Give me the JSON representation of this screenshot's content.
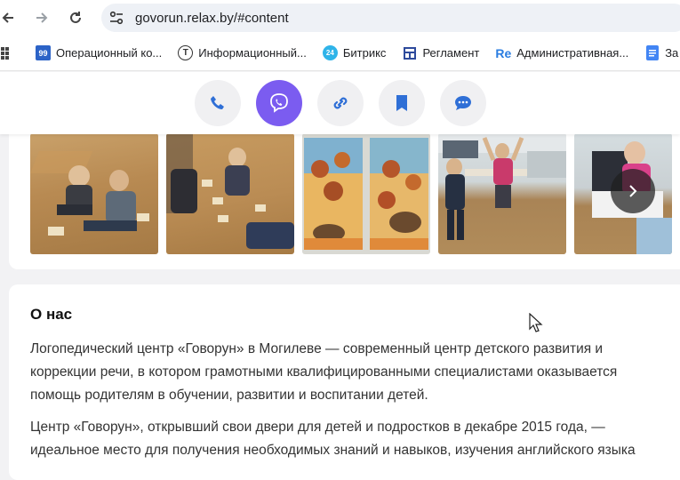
{
  "browser": {
    "url": "govorun.relax.by/#content",
    "bookmarks": [
      {
        "label": "Операционный ко...",
        "icon": "99-icon",
        "icon_text": "99",
        "color": "#2c63c7"
      },
      {
        "label": "Информационный...",
        "icon": "t-circle-icon",
        "icon_text": "T",
        "color": "#333333"
      },
      {
        "label": "Битрикс",
        "icon": "bitrix24-icon",
        "icon_text": "24",
        "color": "#2fb4e9"
      },
      {
        "label": "Регламент",
        "icon": "grid-doc-icon",
        "icon_text": "",
        "color": "#2d4a9c"
      },
      {
        "label": "Административная...",
        "icon": "re-icon",
        "icon_text": "Re",
        "color": "#2a7de1"
      },
      {
        "label": "За",
        "icon": "doc-icon",
        "icon_text": "",
        "color": "#4285f4"
      }
    ]
  },
  "contact_bar": {
    "buttons": [
      {
        "name": "phone",
        "active": false
      },
      {
        "name": "viber",
        "active": true
      },
      {
        "name": "link",
        "active": false
      },
      {
        "name": "bookmark",
        "active": false
      },
      {
        "name": "chat",
        "active": false
      }
    ],
    "accent": "#7b5cf0",
    "icon_color": "#2f6fd6"
  },
  "gallery": {
    "photos": [
      "photo-kids-floor-1",
      "photo-kids-floor-2",
      "photo-autumn-drawings",
      "photo-kids-classroom",
      "photo-girl-classroom"
    ]
  },
  "about": {
    "title": "О нас",
    "paragraph1": "Логопедический центр «Говорун» в Могилеве — современный центр детского развития и коррекции речи, в котором грамотными квалифицированными специалистами оказывается помощь родителям в обучении, развитии и воспитании детей.",
    "paragraph2": "Центр «Говорун», открывший свои двери для детей и подростков в декабре 2015 года, — идеальное место для получения необходимых знаний и навыков, изучения английского языка"
  }
}
